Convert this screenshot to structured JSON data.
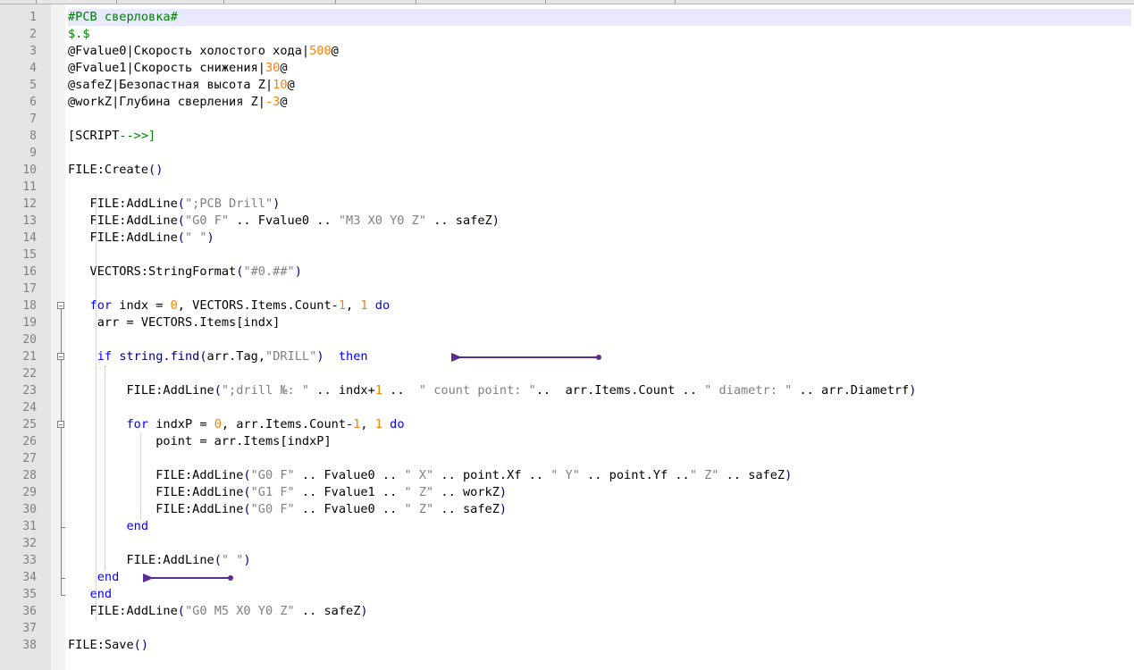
{
  "editor": {
    "current_line": 1,
    "lines": [
      [
        {
          "t": "#PCB сверловка#",
          "c": "t-header"
        }
      ],
      [
        {
          "t": "$.$",
          "c": "t-header"
        }
      ],
      [
        {
          "t": "@Fvalue0|Скорость холостого хода|"
        },
        {
          "t": "500",
          "c": "t-num"
        },
        {
          "t": "@"
        }
      ],
      [
        {
          "t": "@Fvalue1|Скорость снижения|"
        },
        {
          "t": "30",
          "c": "t-num"
        },
        {
          "t": "@"
        }
      ],
      [
        {
          "t": "@safeZ|Безопастная высота Z|"
        },
        {
          "t": "10",
          "c": "t-num"
        },
        {
          "t": "@"
        }
      ],
      [
        {
          "t": "@workZ|Глубина сверления Z|"
        },
        {
          "t": "-3",
          "c": "t-num"
        },
        {
          "t": "@"
        }
      ],
      [],
      [
        {
          "t": "[SCRIPT"
        },
        {
          "t": "-->>]",
          "c": "t-cmt"
        }
      ],
      [],
      [
        {
          "t": "FILE:Create"
        },
        {
          "t": "()",
          "c": "t-op"
        }
      ],
      [],
      [
        {
          "t": "   FILE:AddLine"
        },
        {
          "t": "(",
          "c": "t-op"
        },
        {
          "t": "\";PCB Drill\"",
          "c": "t-str"
        },
        {
          "t": ")",
          "c": "t-op"
        }
      ],
      [
        {
          "t": "   FILE:AddLine"
        },
        {
          "t": "(",
          "c": "t-op"
        },
        {
          "t": "\"G0 F\"",
          "c": "t-str"
        },
        {
          "t": " .. Fvalue0 .. "
        },
        {
          "t": "\"M3 X0 Y0 Z\"",
          "c": "t-str"
        },
        {
          "t": " .. safeZ"
        },
        {
          "t": ")",
          "c": "t-op"
        }
      ],
      [
        {
          "t": "   FILE:AddLine"
        },
        {
          "t": "(",
          "c": "t-op"
        },
        {
          "t": "\" \"",
          "c": "t-str"
        },
        {
          "t": ")",
          "c": "t-op"
        }
      ],
      [],
      [
        {
          "t": "   VECTORS:StringFormat"
        },
        {
          "t": "(",
          "c": "t-op"
        },
        {
          "t": "\"#0.##\"",
          "c": "t-str"
        },
        {
          "t": ")",
          "c": "t-op"
        }
      ],
      [],
      [
        {
          "t": "   "
        },
        {
          "t": "for",
          "c": "t-kw"
        },
        {
          "t": " indx = "
        },
        {
          "t": "0",
          "c": "t-num"
        },
        {
          "t": ", VECTORS.Items.Count-"
        },
        {
          "t": "1",
          "c": "t-num"
        },
        {
          "t": ", "
        },
        {
          "t": "1",
          "c": "t-num"
        },
        {
          "t": " "
        },
        {
          "t": "do",
          "c": "t-kw"
        }
      ],
      [
        {
          "t": "    arr = VECTORS.Items[indx]"
        }
      ],
      [],
      [
        {
          "t": "    "
        },
        {
          "t": "if",
          "c": "t-kw"
        },
        {
          "t": " "
        },
        {
          "t": "string.find",
          "c": "t-fn"
        },
        {
          "t": "(",
          "c": "t-op"
        },
        {
          "t": "arr.Tag,"
        },
        {
          "t": "\"DRILL\"",
          "c": "t-str"
        },
        {
          "t": ")",
          "c": "t-op"
        },
        {
          "t": "  "
        },
        {
          "t": "then",
          "c": "t-kw"
        }
      ],
      [],
      [
        {
          "t": "        FILE:AddLine"
        },
        {
          "t": "(",
          "c": "t-op"
        },
        {
          "t": "\";drill №: \"",
          "c": "t-str"
        },
        {
          "t": " .. indx+"
        },
        {
          "t": "1",
          "c": "t-num"
        },
        {
          "t": " ..  "
        },
        {
          "t": "\" count point: \"",
          "c": "t-str"
        },
        {
          "t": "..  arr.Items.Count .. "
        },
        {
          "t": "\" diametr: \"",
          "c": "t-str"
        },
        {
          "t": " .. arr.Diametrf"
        },
        {
          "t": ")",
          "c": "t-op"
        }
      ],
      [],
      [
        {
          "t": "        "
        },
        {
          "t": "for",
          "c": "t-kw"
        },
        {
          "t": " indxP = "
        },
        {
          "t": "0",
          "c": "t-num"
        },
        {
          "t": ", arr.Items.Count-"
        },
        {
          "t": "1",
          "c": "t-num"
        },
        {
          "t": ", "
        },
        {
          "t": "1",
          "c": "t-num"
        },
        {
          "t": " "
        },
        {
          "t": "do",
          "c": "t-kw"
        }
      ],
      [
        {
          "t": "            point = arr.Items[indxP]"
        }
      ],
      [],
      [
        {
          "t": "            FILE:AddLine"
        },
        {
          "t": "(",
          "c": "t-op"
        },
        {
          "t": "\"G0 F\"",
          "c": "t-str"
        },
        {
          "t": " .. Fvalue0 .. "
        },
        {
          "t": "\" X\"",
          "c": "t-str"
        },
        {
          "t": " .. point.Xf .. "
        },
        {
          "t": "\" Y\"",
          "c": "t-str"
        },
        {
          "t": " .. point.Yf .."
        },
        {
          "t": "\" Z\"",
          "c": "t-str"
        },
        {
          "t": " .. safeZ"
        },
        {
          "t": ")",
          "c": "t-op"
        }
      ],
      [
        {
          "t": "            FILE:AddLine"
        },
        {
          "t": "(",
          "c": "t-op"
        },
        {
          "t": "\"G1 F\"",
          "c": "t-str"
        },
        {
          "t": " .. Fvalue1 .. "
        },
        {
          "t": "\" Z\"",
          "c": "t-str"
        },
        {
          "t": " .. workZ"
        },
        {
          "t": ")",
          "c": "t-op"
        }
      ],
      [
        {
          "t": "            FILE:AddLine"
        },
        {
          "t": "(",
          "c": "t-op"
        },
        {
          "t": "\"G0 F\"",
          "c": "t-str"
        },
        {
          "t": " .. Fvalue0 .. "
        },
        {
          "t": "\" Z\"",
          "c": "t-str"
        },
        {
          "t": " .. safeZ"
        },
        {
          "t": ")",
          "c": "t-op"
        }
      ],
      [
        {
          "t": "        "
        },
        {
          "t": "end",
          "c": "t-kw"
        }
      ],
      [],
      [
        {
          "t": "        FILE:AddLine"
        },
        {
          "t": "(",
          "c": "t-op"
        },
        {
          "t": "\" \"",
          "c": "t-str"
        },
        {
          "t": ")",
          "c": "t-op"
        }
      ],
      [
        {
          "t": "    "
        },
        {
          "t": "end",
          "c": "t-kw"
        }
      ],
      [
        {
          "t": "   "
        },
        {
          "t": "end",
          "c": "t-kw"
        }
      ],
      [
        {
          "t": "   FILE:AddLine"
        },
        {
          "t": "(",
          "c": "t-op"
        },
        {
          "t": "\"G0 M5 X0 Y0 Z\"",
          "c": "t-str"
        },
        {
          "t": " .. safeZ"
        },
        {
          "t": ")",
          "c": "t-op"
        }
      ],
      [],
      [
        {
          "t": "FILE:Save"
        },
        {
          "t": "()",
          "c": "t-op"
        }
      ]
    ]
  },
  "fold_markers": [
    18,
    21,
    25
  ],
  "fold_ends": [
    31,
    34,
    35
  ],
  "annotations": {
    "arrow_color": "#5b2d8e",
    "arrows": [
      {
        "points_to_line": 21,
        "points_to": "then"
      },
      {
        "points_to_line": 34,
        "points_to": "end"
      }
    ]
  }
}
